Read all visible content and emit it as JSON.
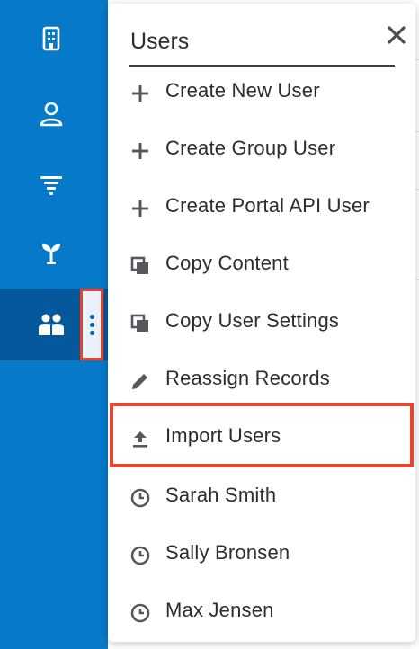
{
  "sidebar": {
    "items": [
      {
        "icon": "building-icon"
      },
      {
        "icon": "contact-icon"
      },
      {
        "icon": "funnel-icon"
      },
      {
        "icon": "sprout-icon"
      },
      {
        "icon": "users-icon"
      }
    ]
  },
  "menu": {
    "title": "Users",
    "close_icon": "close-icon",
    "items": [
      {
        "label": "Create New User",
        "icon": "plus-icon"
      },
      {
        "label": "Create Group User",
        "icon": "plus-icon"
      },
      {
        "label": "Create Portal API User",
        "icon": "plus-icon"
      },
      {
        "label": "Copy Content",
        "icon": "copy-icon"
      },
      {
        "label": "Copy User Settings",
        "icon": "copy-icon"
      },
      {
        "label": "Reassign Records",
        "icon": "pencil-icon"
      },
      {
        "label": "Import Users",
        "icon": "upload-icon"
      },
      {
        "label": "Sarah Smith",
        "icon": "clock-icon"
      },
      {
        "label": "Sally Bronsen",
        "icon": "clock-icon"
      },
      {
        "label": "Max Jensen",
        "icon": "clock-icon"
      }
    ]
  },
  "colors": {
    "sidebar": "#0679c9",
    "sidebar_active": "#05589c",
    "highlight_border": "#e5452d",
    "text": "#2b2d31",
    "icon": "#55585d"
  }
}
